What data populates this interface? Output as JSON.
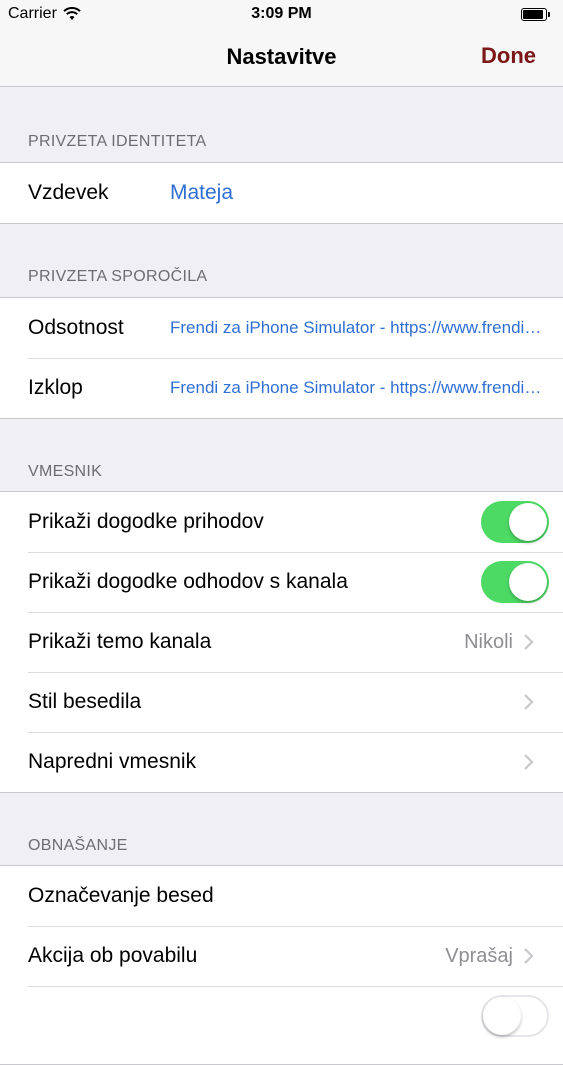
{
  "status_bar": {
    "carrier": "Carrier",
    "time": "3:09 PM"
  },
  "nav": {
    "title": "Nastavitve",
    "done_label": "Done"
  },
  "sections": {
    "identity": {
      "header": "PRIVZETA IDENTITETA",
      "nickname_label": "Vzdevek",
      "nickname_value": "Mateja"
    },
    "messages": {
      "header": "PRIVZETA SPOROČILA",
      "away_label": "Odsotnost",
      "away_value": "Frendi za iPhone Simulator - https://www.frendi.com",
      "quit_label": "Izklop",
      "quit_value": "Frendi za iPhone Simulator - https://www.frendi.com"
    },
    "interface": {
      "header": "VMESNIK",
      "show_joins_label": "Prikaži dogodke prihodov",
      "show_joins_on": true,
      "show_parts_label": "Prikaži dogodke odhodov s kanala",
      "show_parts_on": true,
      "show_topic_label": "Prikaži temo kanala",
      "show_topic_value": "Nikoli",
      "text_style_label": "Stil besedila",
      "advanced_label": "Napredni vmesnik"
    },
    "behavior": {
      "header": "OBNAŠANJE",
      "highlight_label": "Označevanje besed",
      "invite_label": "Akcija ob povabilu",
      "invite_value": "Vprašaj",
      "last_row_toggle_on": false
    }
  },
  "colors": {
    "accent_done": "#7b1716",
    "link_blue": "#2f6fd4",
    "toggle_on": "#4cd964",
    "background": "#efeff4"
  }
}
